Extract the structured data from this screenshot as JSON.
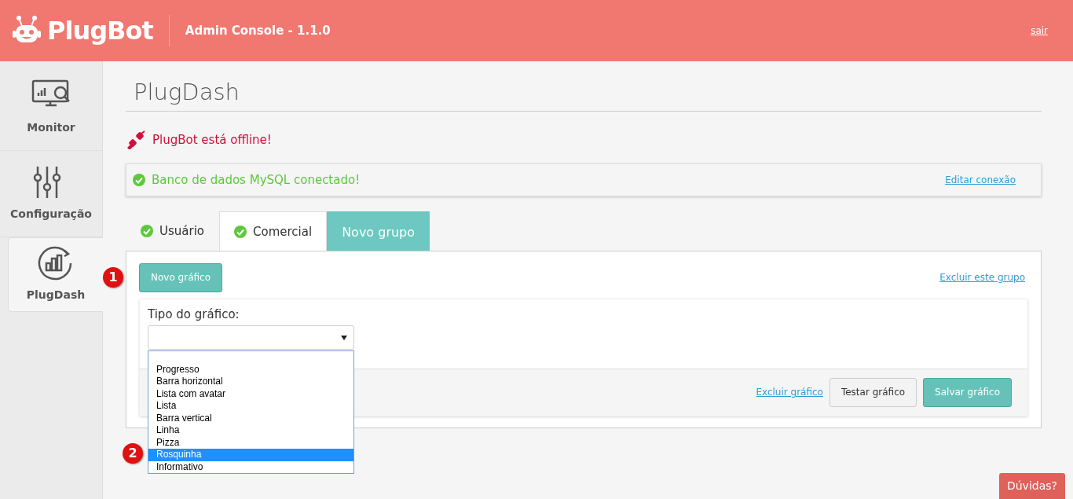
{
  "header": {
    "brand": "PlugBot",
    "subtitle": "Admin Console - 1.1.0",
    "logout": "sair"
  },
  "sidebar": {
    "items": [
      {
        "label": "Monitor",
        "selected": false
      },
      {
        "label": "Configuração",
        "selected": false
      },
      {
        "label": "PlugDash",
        "selected": true
      }
    ]
  },
  "page_title": "PlugDash",
  "offline_message": "PlugBot está offline!",
  "db_alert": {
    "text": "Banco de dados MySQL conectado!",
    "link": "Editar conexão"
  },
  "tabs": [
    {
      "label": "Usuário",
      "kind": "group",
      "selected": false
    },
    {
      "label": "Comercial",
      "kind": "group",
      "selected": true
    },
    {
      "label": "Novo grupo",
      "kind": "new",
      "selected": false
    }
  ],
  "panel": {
    "new_chart_button": "Novo gráfico",
    "delete_group_link": "Excluir este grupo",
    "chart_form": {
      "type_label": "Tipo do gráfico:",
      "type_options": [
        {
          "label": "Progresso",
          "selected": false
        },
        {
          "label": "Barra horizontal",
          "selected": false
        },
        {
          "label": "Lista com avatar",
          "selected": false
        },
        {
          "label": "Lista",
          "selected": false
        },
        {
          "label": "Barra vertical",
          "selected": false
        },
        {
          "label": "Linha",
          "selected": false
        },
        {
          "label": "Pizza",
          "selected": false
        },
        {
          "label": "Rosquinha",
          "selected": true
        },
        {
          "label": "Informativo",
          "selected": false
        }
      ],
      "delete_link": "Excluir gráfico",
      "test_button": "Testar gráfico",
      "save_button": "Salvar gráfico"
    }
  },
  "callouts": [
    "1",
    "2"
  ],
  "help_button": "Dúvidas?"
}
